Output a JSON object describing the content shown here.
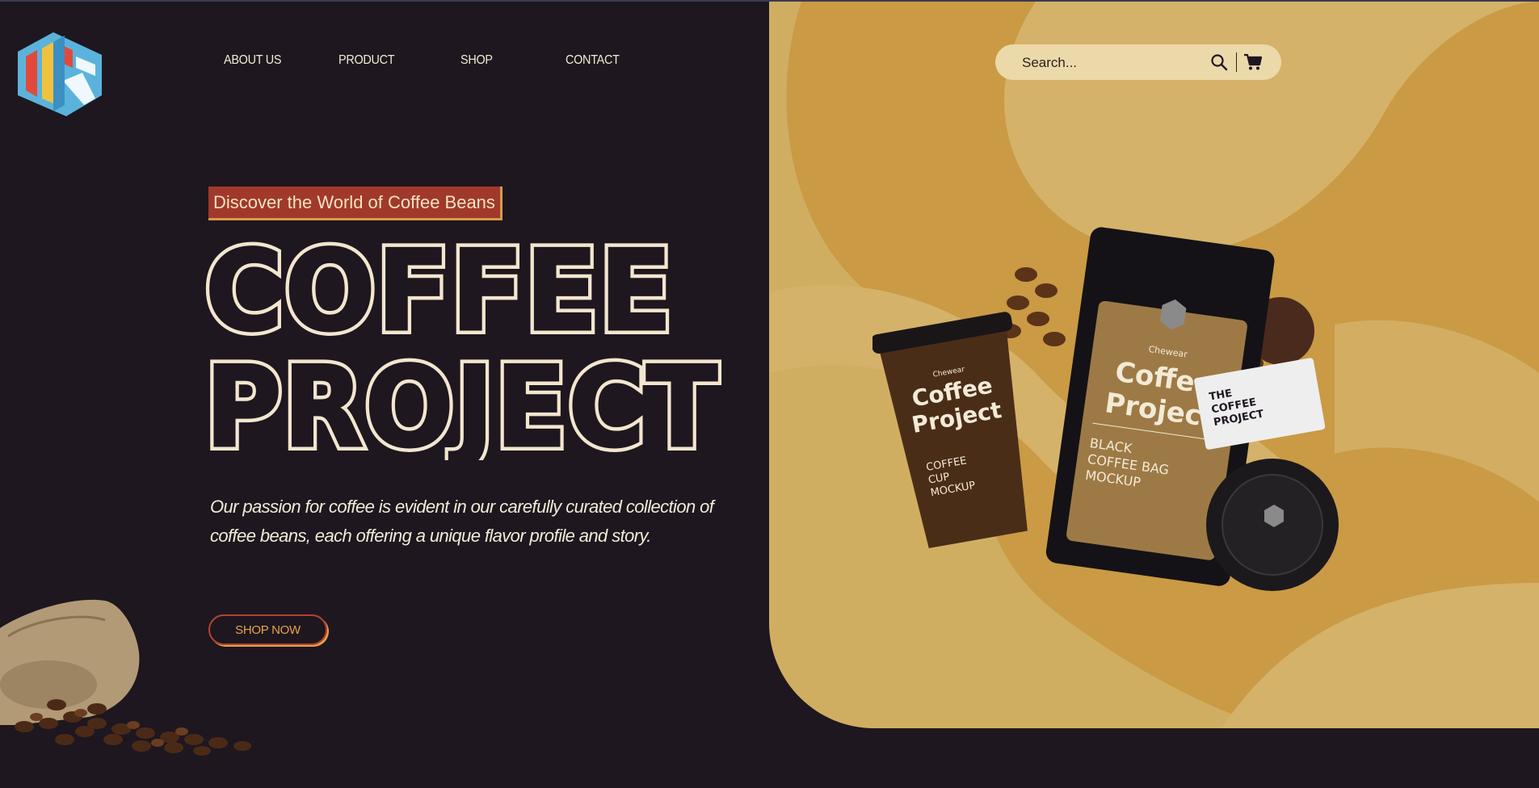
{
  "nav": {
    "items": [
      {
        "label": "ABOUT US"
      },
      {
        "label": "PRODUCT"
      },
      {
        "label": "SHOP"
      },
      {
        "label": "CONTACT"
      }
    ]
  },
  "search": {
    "placeholder": "Search...",
    "icon": "search-icon",
    "cart_icon": "cart-icon"
  },
  "hero": {
    "tagline": "Discover the World of Coffee Beans",
    "title_line1": "COFFEE",
    "title_line2": "PROJECT",
    "description": "Our passion for coffee is evident in our carefully curated collection of coffee beans, each offering a unique flavor profile and story.",
    "cta_label": "SHOP NOW"
  },
  "product_mockup": {
    "cup_brand": "Chewear",
    "cup_title": "Coffee Project",
    "cup_label": "COFFEE CUP MOCKUP",
    "bag_brand": "Chewear",
    "bag_title": "Coffee Project",
    "bag_label": "BLACK COFFEE BAG MOCKUP",
    "card_title": "THE COFFEE PROJECT"
  },
  "colors": {
    "background": "#1e171f",
    "panel": "#d0ae61",
    "accent_red": "#a0392b",
    "accent_orange": "#e9a24c",
    "cream": "#f3ead7"
  }
}
